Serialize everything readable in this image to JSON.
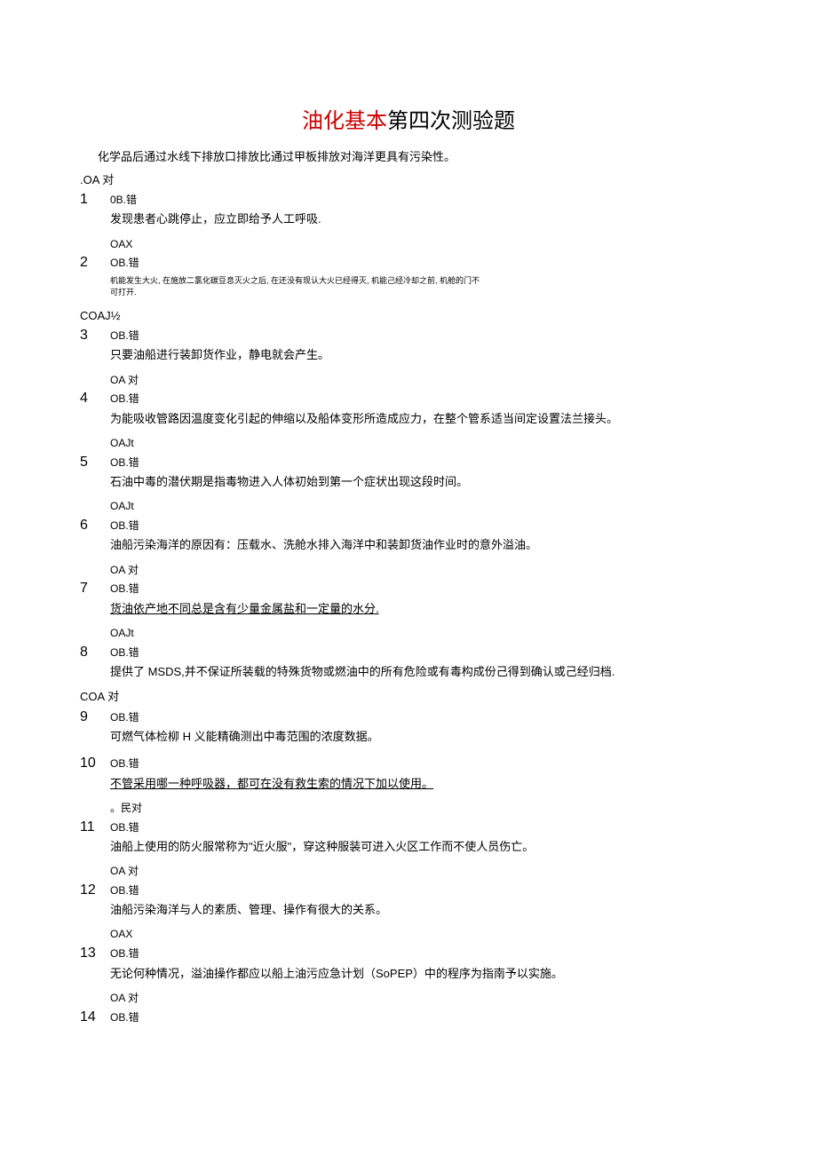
{
  "title": {
    "red": "油化基本",
    "black": "第四次测验题"
  },
  "intro": "化学品后通过水线下排放口排放比通过甲板排放对海洋更具有污染性。",
  "q1": {
    "prefix": ".OA 对",
    "num": "1",
    "ob": "0B.错",
    "text": "发现患者心跳停止，应立即给予人工呼吸."
  },
  "q2": {
    "oa": "OAX",
    "num": "2",
    "ob": "OB.错",
    "text1": "机能发生大火, 在施放二氯化碳豆息灭火之后, 在还没有现认大火已经得灭, 机能己经冷却之前, 机舱的门不",
    "text2": "可打开."
  },
  "q3": {
    "prefix": "COAJ½",
    "num": "3",
    "ob": "OB.错",
    "text": "只要油船进行装卸货作业，静电就会产生。"
  },
  "q4": {
    "oa": "OA 对",
    "num": "4",
    "ob": "OB.错",
    "text": "为能吸收管路因温度变化引起的伸缩以及船体变形所造成应力，在整个管系适当间定设置法兰接头。"
  },
  "q5": {
    "oa": "OAJt",
    "num": "5",
    "ob": "OB.错",
    "text": "石油中毒的潜伏期是指毒物进入人体初始到第一个症状出现这段时间。"
  },
  "q6": {
    "oa": "OAJt",
    "num": "6",
    "ob": "OB.错",
    "text": "油船污染海洋的原因有：压载水、洗舱水排入海洋中和装卸货油作业时的意外溢油。"
  },
  "q7": {
    "oa": "OA 对",
    "num": "7",
    "ob": "OB.错",
    "text": "货油依产地不同总是含有少量金属盐和一定量的水分."
  },
  "q8": {
    "oa": "OAJt",
    "num": "8",
    "ob": "OB.错",
    "text": "提供了 MSDS,并不保证所装载的特殊货物或燃油中的所有危险或有毒构成份己得到确认或己经归档."
  },
  "q9": {
    "prefix": "COA 对",
    "num": "9",
    "ob": "OB.错",
    "text": "可燃气体检柳 H 义能精确测出中毒范围的浓度数据。"
  },
  "q10": {
    "num": "10",
    "ob": "OB.错",
    "text": "不管采用哪一种呼吸器，都可在没有救生索的情况下加以使用。"
  },
  "q11": {
    "oa": "。民对",
    "num": "11",
    "ob": "OB.错",
    "text": "油船上使用的防火服常称为\"近火服\"，穿这种服装可进入火区工作而不使人员伤亡。"
  },
  "q12": {
    "oa": "OA 对",
    "num": "12",
    "ob": "OB.错",
    "text": "油船污染海洋与人的素质、管理、操作有很大的关系。"
  },
  "q13": {
    "oa": "OAX",
    "num": "13",
    "ob": "OB.错",
    "text": "无论何种情况，溢油操作都应以船上油污应急计划（SoPEP）中的程序为指南予以实施。"
  },
  "q14": {
    "oa": "OA 对",
    "num": "14",
    "ob": "OB.错"
  }
}
